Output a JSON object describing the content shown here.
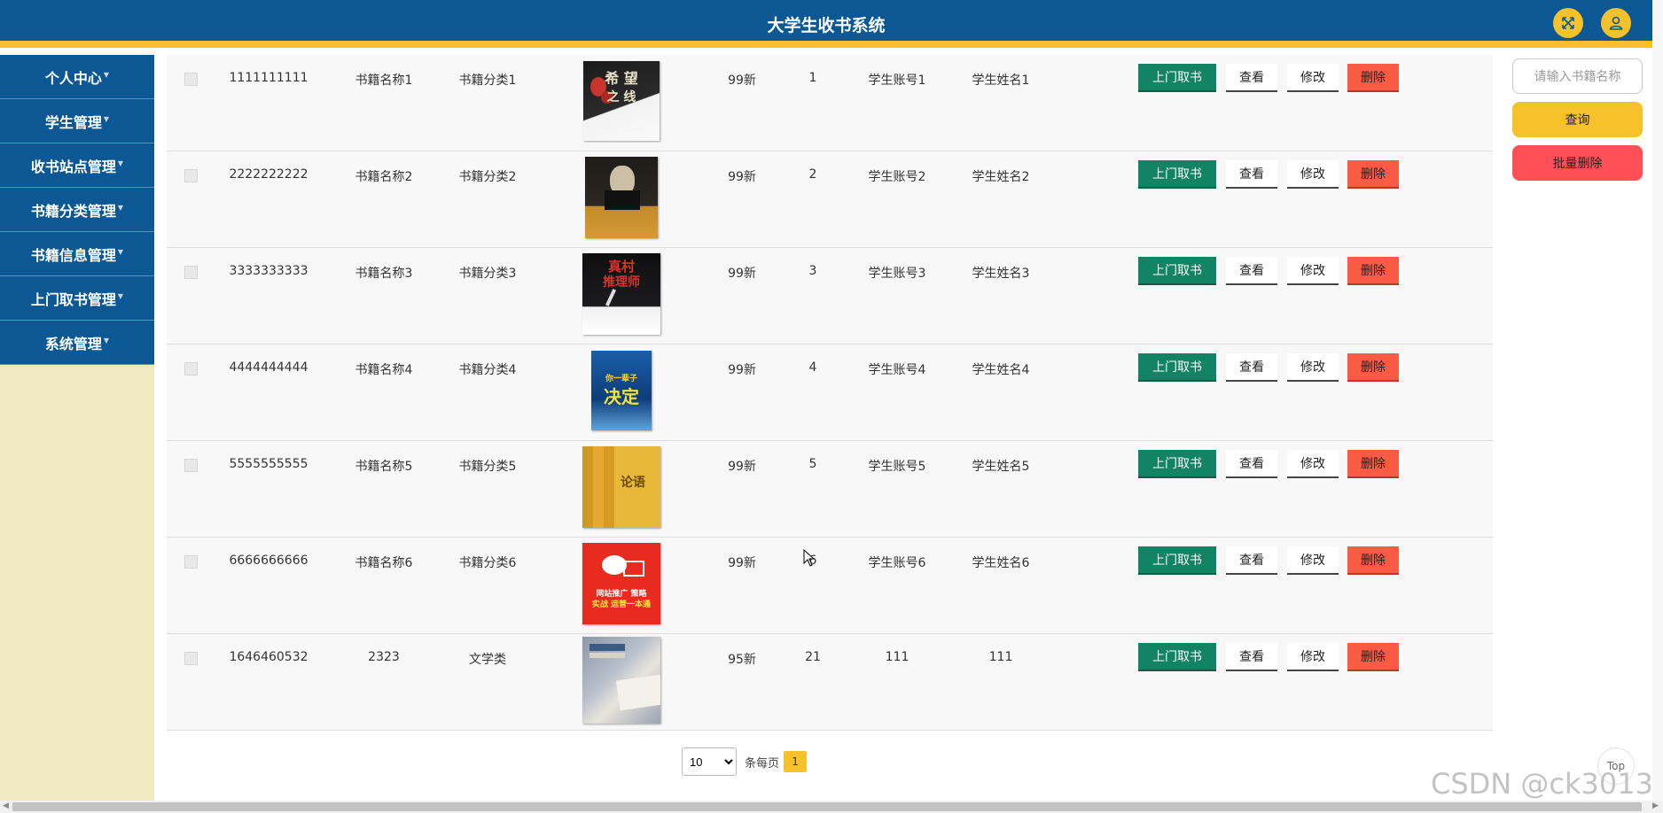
{
  "header": {
    "title": "大学生收书系统"
  },
  "sidebar": {
    "items": [
      {
        "label": "个人中心"
      },
      {
        "label": "学生管理"
      },
      {
        "label": "收书站点管理"
      },
      {
        "label": "书籍分类管理"
      },
      {
        "label": "书籍信息管理"
      },
      {
        "label": "上门取书管理"
      },
      {
        "label": "系统管理"
      }
    ]
  },
  "table": {
    "rows": [
      {
        "id": "1111111111",
        "name": "书籍名称1",
        "category": "书籍分类1",
        "condition": "99新",
        "quantity": "1",
        "account": "学生账号1",
        "student": "学生姓名1",
        "cover_icon": "book-cover-1"
      },
      {
        "id": "2222222222",
        "name": "书籍名称2",
        "category": "书籍分类2",
        "condition": "99新",
        "quantity": "2",
        "account": "学生账号2",
        "student": "学生姓名2",
        "cover_icon": "book-cover-2"
      },
      {
        "id": "3333333333",
        "name": "书籍名称3",
        "category": "书籍分类3",
        "condition": "99新",
        "quantity": "3",
        "account": "学生账号3",
        "student": "学生姓名3",
        "cover_icon": "book-cover-3"
      },
      {
        "id": "4444444444",
        "name": "书籍名称4",
        "category": "书籍分类4",
        "condition": "99新",
        "quantity": "4",
        "account": "学生账号4",
        "student": "学生姓名4",
        "cover_icon": "book-cover-4"
      },
      {
        "id": "5555555555",
        "name": "书籍名称5",
        "category": "书籍分类5",
        "condition": "99新",
        "quantity": "5",
        "account": "学生账号5",
        "student": "学生姓名5",
        "cover_icon": "book-cover-5"
      },
      {
        "id": "6666666666",
        "name": "书籍名称6",
        "category": "书籍分类6",
        "condition": "99新",
        "quantity": "6",
        "account": "学生账号6",
        "student": "学生姓名6",
        "cover_icon": "book-cover-6"
      },
      {
        "id": "1646460532",
        "name": "2323",
        "category": "文学类",
        "condition": "95新",
        "quantity": "21",
        "account": "111",
        "student": "111",
        "cover_icon": "book-photo"
      }
    ],
    "actions": {
      "pickup": "上门取书",
      "view": "查看",
      "edit": "修改",
      "delete": "删除"
    }
  },
  "pagination": {
    "page_size": "10",
    "per_page_label": "条每页",
    "current_page": "1"
  },
  "search": {
    "placeholder": "请输入书籍名称",
    "query_label": "查询",
    "batch_delete_label": "批量删除"
  },
  "top_button": "Top",
  "watermark": "CSDN @ck3013",
  "colors": {
    "primary": "#0b5895",
    "accent": "#f6c12a",
    "pickup": "#138463",
    "delete": "#fb5b45",
    "batch_delete": "#ff4f57"
  }
}
